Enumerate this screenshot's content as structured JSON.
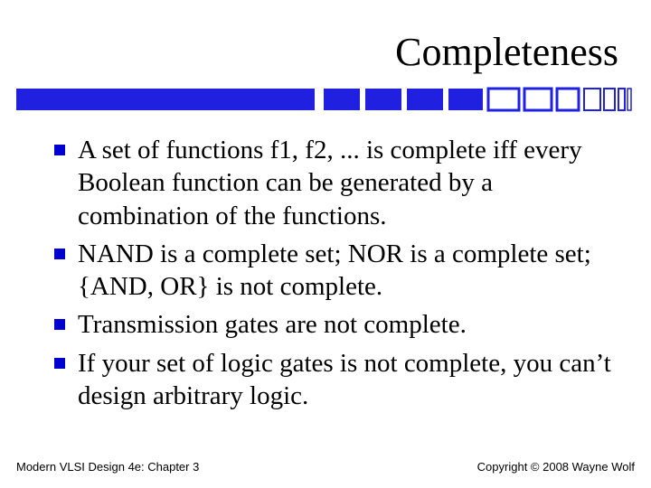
{
  "title": "Completeness",
  "bullets": [
    "A set of functions f1, f2, ... is complete iff every Boolean function can be generated by a combination of the functions.",
    "NAND is a complete set; NOR is a complete set; {AND, OR} is not complete.",
    "Transmission gates are not complete.",
    "If your set of logic gates is not complete, you can’t design arbitrary logic."
  ],
  "footer_left": "Modern VLSI Design 4e: Chapter 3",
  "footer_right": "Copyright © 2008 Wayne Wolf"
}
